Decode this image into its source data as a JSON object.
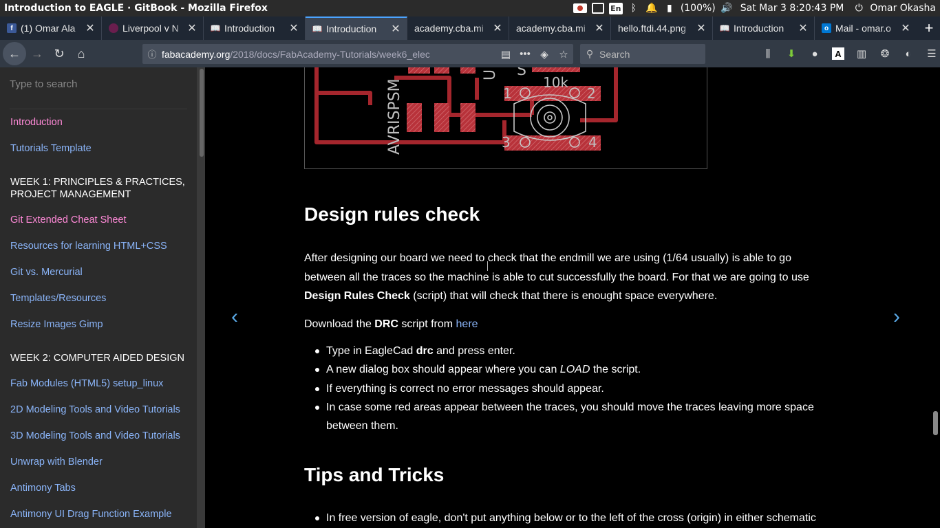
{
  "os": {
    "window_title": "Introduction to EAGLE · GitBook - Mozilla Firefox",
    "battery": "(100%)",
    "datetime": "Sat Mar  3  8:20:43 PM",
    "user": "Omar Okasha",
    "keyboard_layout": "En"
  },
  "tabs": [
    {
      "label": "(1) Omar Ala",
      "favicon": "facebook-icon",
      "active": false
    },
    {
      "label": "Liverpool v N",
      "favicon": "lfc-icon",
      "active": false
    },
    {
      "label": "Introduction",
      "favicon": "gitbook-icon",
      "active": false
    },
    {
      "label": "Introduction",
      "favicon": "gitbook-icon",
      "active": true
    },
    {
      "label": "academy.cba.mi",
      "favicon": "",
      "active": false
    },
    {
      "label": "academy.cba.mi",
      "favicon": "",
      "active": false
    },
    {
      "label": "hello.ftdi.44.png",
      "favicon": "",
      "active": false
    },
    {
      "label": "Introduction",
      "favicon": "gitbook-icon",
      "active": false
    },
    {
      "label": "Mail - omar.o",
      "favicon": "outlook-icon",
      "active": false
    }
  ],
  "navbar": {
    "url_host": "fabacademy.org",
    "url_path": "/2018/docs/FabAcademy-Tutorials/week6_elec",
    "search_placeholder": "Search"
  },
  "sidebar": {
    "search_placeholder": "Type to search",
    "items": [
      {
        "label": "Introduction",
        "kind": "link-pink"
      },
      {
        "label": "Tutorials Template",
        "kind": "link-blue"
      },
      {
        "label": "WEEK 1: PRINCIPLES & PRACTICES, PROJECT MANAGEMENT",
        "kind": "header"
      },
      {
        "label": "Git Extended Cheat Sheet",
        "kind": "link-pink"
      },
      {
        "label": "Resources for learning HTML+CSS",
        "kind": "link-blue"
      },
      {
        "label": "Git vs. Mercurial",
        "kind": "link-blue"
      },
      {
        "label": "Templates/Resources",
        "kind": "link-blue"
      },
      {
        "label": "Resize Images Gimp",
        "kind": "link-blue"
      },
      {
        "label": "WEEK 2: COMPUTER AIDED DESIGN",
        "kind": "header"
      },
      {
        "label": "Fab Modules (HTML5) setup_linux",
        "kind": "link-blue"
      },
      {
        "label": "2D Modeling Tools and Video Tutorials",
        "kind": "link-blue"
      },
      {
        "label": "3D Modeling Tools and Video Tutorials",
        "kind": "link-blue"
      },
      {
        "label": "Unwrap with Blender",
        "kind": "link-blue"
      },
      {
        "label": "Antimony Tabs",
        "kind": "link-blue"
      },
      {
        "label": "Antimony UI Drag Function Example",
        "kind": "link-blue"
      }
    ]
  },
  "pcb": {
    "labels": [
      "AVRISPSM",
      "U",
      "S",
      "10k",
      "1",
      "2",
      "3",
      "4"
    ]
  },
  "content": {
    "h2_drc": "Design rules check",
    "p1_a": "After designing our board we need to check that the endmill we are using (1/64 usually) is able to go between all the traces so the machine is able to cut successfully the board. For that we are going to use ",
    "p1_bold": "Design Rules Check",
    "p1_b": " (script) that will check that there is enought space everywhere.",
    "p2_a": "Download the ",
    "p2_bold": "DRC",
    "p2_b": " script from ",
    "p2_link": "here",
    "bullets": [
      {
        "pre": "Type in EagleCad ",
        "bold": "drc",
        "post": " and press enter."
      },
      {
        "pre": "A new dialog box should appear where you can ",
        "em": "LOAD",
        "post": " the script."
      },
      {
        "pre": "If everything is correct no error messages should appear.",
        "post": ""
      },
      {
        "pre": "In case some red areas appear between the traces, you should move the traces leaving more space between them.",
        "post": ""
      }
    ],
    "h2_tips": "Tips and Tricks",
    "tips_bullet": "In free version of eagle, don't put anything below or to the left of the cross (origin) in either schematic"
  }
}
